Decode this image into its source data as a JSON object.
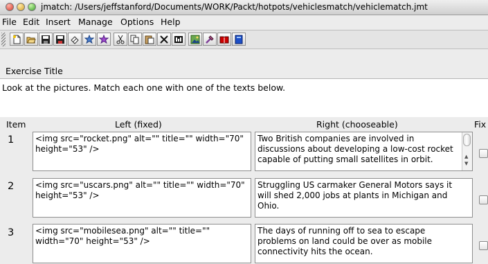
{
  "window": {
    "title": "jmatch: /Users/jeffstanford/Documents/WORK/Packt/hotpots/vehiclesmatch/vehiclematch.jmt"
  },
  "menu": [
    "File",
    "Edit",
    "Insert",
    "Manage",
    "Options",
    "Help"
  ],
  "toolbar": {
    "icons": [
      "new-icon",
      "open-icon",
      "save-icon",
      "save-as-icon",
      "eraser-icon",
      "export-icon",
      "export-all-icon",
      "cut-icon",
      "copy-icon",
      "paste-icon",
      "delete-icon",
      "text-icon",
      "image-icon",
      "tool-icon",
      "book-icon",
      "help-book-icon"
    ]
  },
  "exercise": {
    "label": "Exercise Title",
    "value": "Look at the pictures. Match each one with one of the texts below."
  },
  "table": {
    "headers": {
      "item": "Item",
      "left": "Left (fixed)",
      "right": "Right (chooseable)",
      "fix": "Fix"
    },
    "rows": [
      {
        "num": "1",
        "left": "<img src=\"rocket.png\" alt=\"\" title=\"\" width=\"70\" height=\"53\"  />",
        "right": "Two British companies are involved in discussions about developing a low-cost rocket capable of putting small satellites in orbit."
      },
      {
        "num": "2",
        "left": "<img src=\"uscars.png\" alt=\"\" title=\"\" width=\"70\" height=\"53\"  />",
        "right": "Struggling US carmaker General Motors says it will shed 2,000 jobs at plants in Michigan and Ohio."
      },
      {
        "num": "3",
        "left": "<img src=\"mobilesea.png\" alt=\"\" title=\"\" width=\"70\" height=\"53\"  />",
        "right": "The days of running off to sea to escape problems on land could be over as mobile connectivity hits the ocean."
      }
    ]
  }
}
